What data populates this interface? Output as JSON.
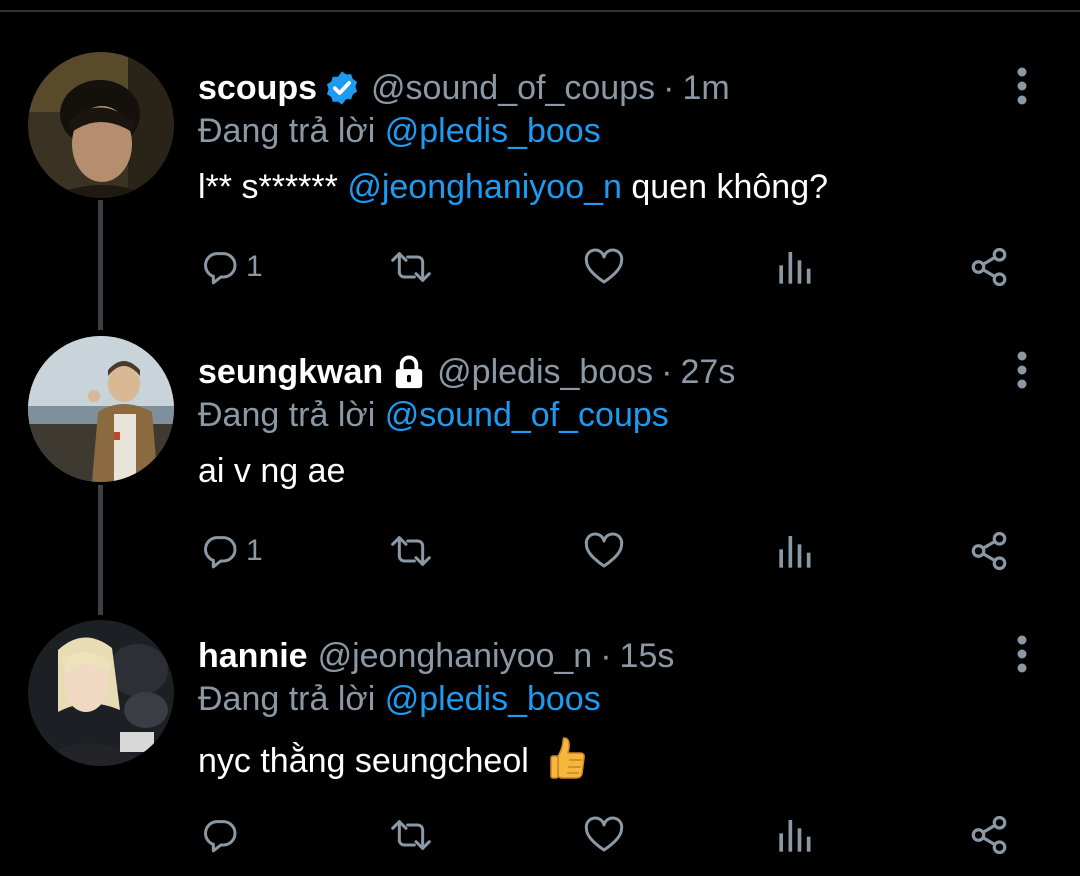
{
  "colors": {
    "background": "#000000",
    "name": "#ffffff",
    "secondary": "#8b98a5",
    "mention": "#1d9bf0",
    "thread_line": "#3d4145"
  },
  "tweets": [
    {
      "name": "scoups",
      "badge": "verified-badge-icon",
      "handle": "@sound_of_coups",
      "time": "1m",
      "reply_prefix": "Đang trả lời",
      "reply_to": "@pledis_boos",
      "text_before": "l** s****** ",
      "text_mention": "@jeonghaniyoo_n",
      "text_after": " quen không?",
      "reply_count": "1"
    },
    {
      "name": "seungkwan",
      "badge": "lock-icon",
      "handle": "@pledis_boos",
      "time": "27s",
      "reply_prefix": "Đang trả lời",
      "reply_to": "@sound_of_coups",
      "text": "ai v ng ae",
      "reply_count": "1"
    },
    {
      "name": "hannie",
      "handle": "@jeonghaniyoo_n",
      "time": "15s",
      "reply_prefix": "Đang trả lời",
      "reply_to": "@pledis_boos",
      "text": "nyc thằng seungcheol",
      "emoji": "thumbs-up-emoji",
      "reply_count": ""
    }
  ],
  "separator": "·"
}
